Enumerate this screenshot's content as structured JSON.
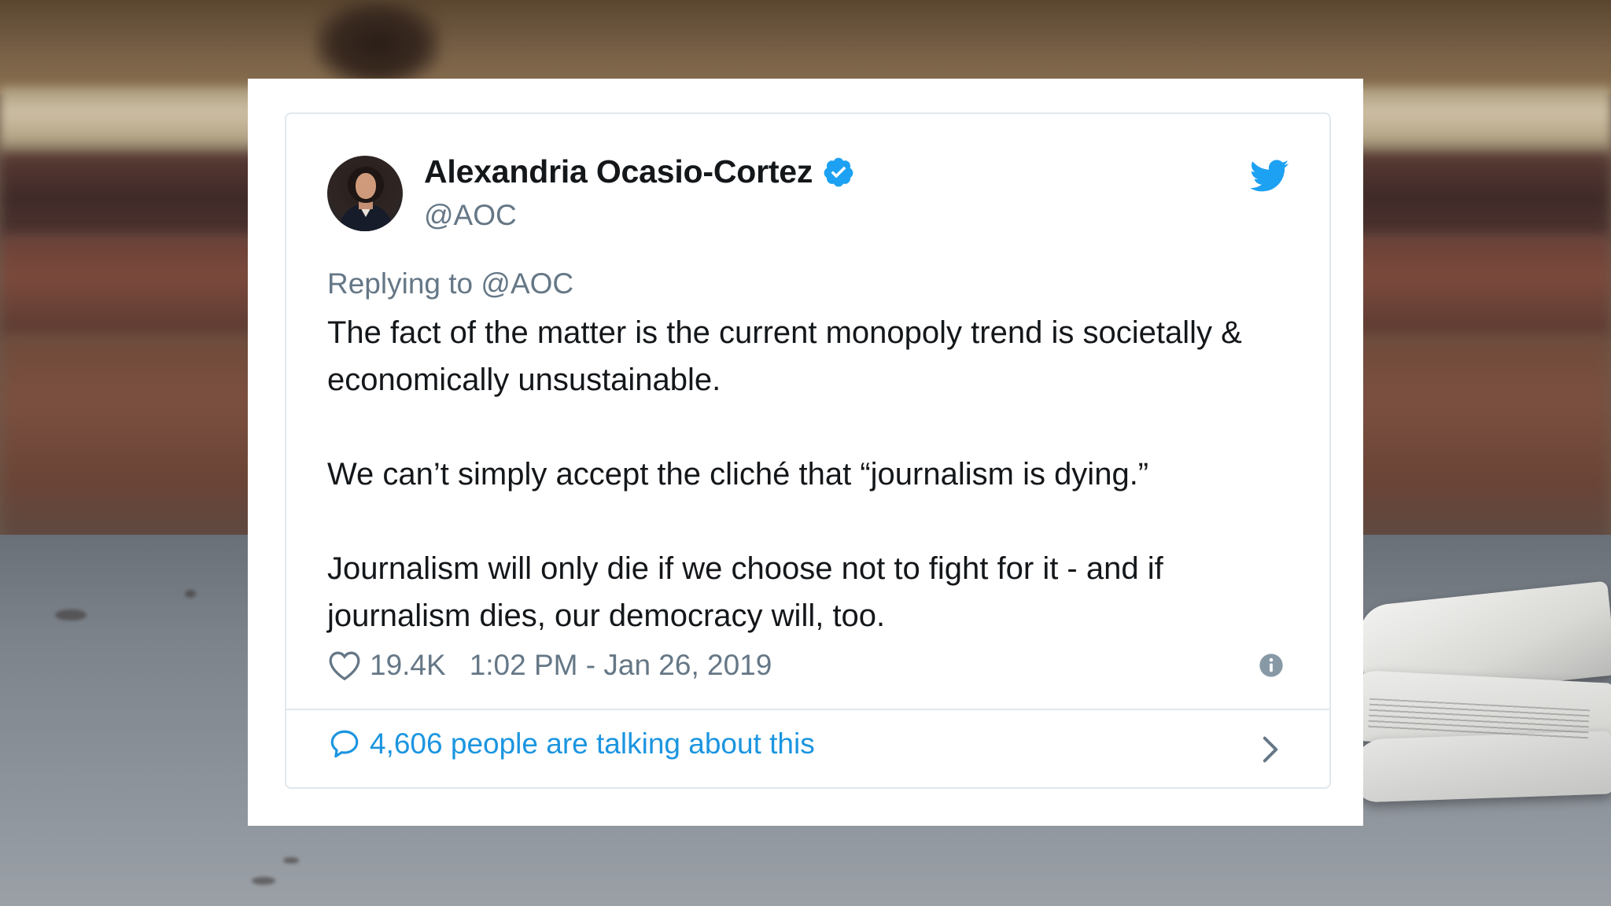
{
  "tweet": {
    "author": {
      "display_name": "Alexandria Ocasio-Cortez",
      "handle": "@AOC",
      "verified": true
    },
    "replying_to": "Replying to @AOC",
    "paragraphs": [
      "The fact of the matter is the current monopoly trend is societally & economically unsustainable.",
      "We can’t simply accept the cliché that “journalism is dying.”",
      "Journalism will only die if we choose not to fight for it - and if journalism dies, our democracy will, too."
    ],
    "likes": "19.4K",
    "timestamp": "1:02 PM - Jan 26, 2019",
    "talking_about": "4,606 people are talking about this"
  },
  "icons": {
    "verified": "verified-badge-icon",
    "brand": "twitter-bird-icon",
    "like": "heart-icon",
    "info": "info-icon",
    "reply": "speech-bubble-icon",
    "more": "chevron-right-icon"
  },
  "colors": {
    "brand_blue": "#1da1f2",
    "link_blue": "#1b95e0",
    "text_primary": "#14171a",
    "text_secondary": "#657786",
    "border": "#e1e8ed"
  }
}
